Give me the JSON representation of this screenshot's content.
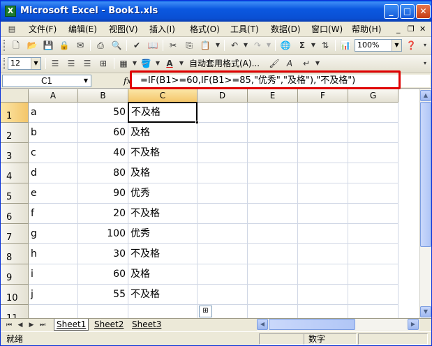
{
  "window": {
    "title": "Microsoft Excel - Book1.xls",
    "app_icon": "excel-x-icon",
    "controls": {
      "minimize": "_",
      "maximize": "□",
      "close": "✕"
    }
  },
  "menu": {
    "items": [
      {
        "label": "文件(F)"
      },
      {
        "label": "编辑(E)"
      },
      {
        "label": "视图(V)"
      },
      {
        "label": "插入(I)"
      },
      {
        "label": "格式(O)"
      },
      {
        "label": "工具(T)"
      },
      {
        "label": "数据(D)"
      },
      {
        "label": "窗口(W)"
      },
      {
        "label": "帮助(H)"
      }
    ],
    "doc_controls": {
      "minimize": "_",
      "restore": "❐",
      "close": "✕"
    }
  },
  "toolbar1": {
    "zoom": "100%"
  },
  "toolbar2": {
    "font_size": "12",
    "autoformat_label": "自动套用格式(A)..."
  },
  "formula_bar": {
    "name_box": "C1",
    "fx": "fx",
    "formula": "=IF(B1>=60,IF(B1>=85,\"优秀\",\"及格\"),\"不及格\")"
  },
  "sheet": {
    "columns": [
      "A",
      "B",
      "C",
      "D",
      "E",
      "F",
      "G"
    ],
    "active_cell": "C1",
    "rows": [
      {
        "num": "1",
        "a": "a",
        "b": "50",
        "c": "不及格"
      },
      {
        "num": "2",
        "a": "b",
        "b": "60",
        "c": "及格"
      },
      {
        "num": "3",
        "a": "c",
        "b": "40",
        "c": "不及格"
      },
      {
        "num": "4",
        "a": "d",
        "b": "80",
        "c": "及格"
      },
      {
        "num": "5",
        "a": "e",
        "b": "90",
        "c": "优秀"
      },
      {
        "num": "6",
        "a": "f",
        "b": "20",
        "c": "不及格"
      },
      {
        "num": "7",
        "a": "g",
        "b": "100",
        "c": "优秀"
      },
      {
        "num": "8",
        "a": "h",
        "b": "30",
        "c": "不及格"
      },
      {
        "num": "9",
        "a": "i",
        "b": "60",
        "c": "及格"
      },
      {
        "num": "10",
        "a": "j",
        "b": "55",
        "c": "不及格"
      },
      {
        "num": "11",
        "a": "",
        "b": "",
        "c": ""
      }
    ]
  },
  "tabs": {
    "sheets": [
      "Sheet1",
      "Sheet2",
      "Sheet3"
    ],
    "active": "Sheet1"
  },
  "status": {
    "left": "就绪",
    "mode": "数字"
  },
  "colors": {
    "titlebar": "#0a4fd3",
    "highlight": "#e00000",
    "active_header": "#f4c66a"
  }
}
